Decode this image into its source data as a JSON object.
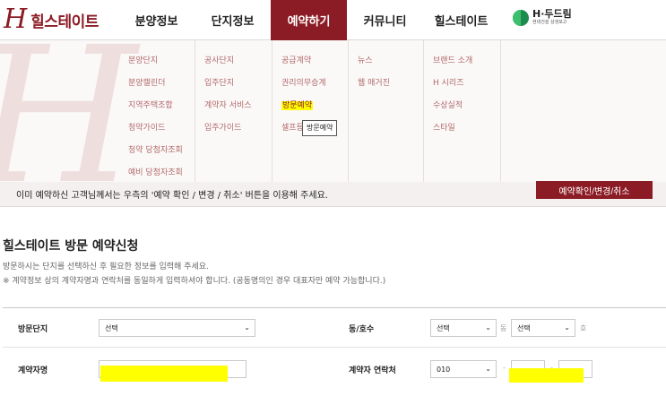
{
  "header": {
    "logo_mark": "H",
    "logo_text": "힐스테이트",
    "nav": [
      "분양정보",
      "단지정보",
      "예약하기",
      "커뮤니티",
      "힐스테이트"
    ],
    "partner_title": "H·두드림",
    "partner_sub": "현대건설 상생포고"
  },
  "mega_menu": {
    "columns": [
      [
        "분양단지",
        "분양캘린더",
        "지역주택조합",
        "청약가이드",
        "청약 당첨자조회",
        "예비 당첨자조회"
      ],
      [
        "공사단지",
        "입주단지",
        "계약자 서비스",
        "입주가이드"
      ],
      [
        "공급계약",
        "권리의무승계",
        "방문예약",
        "셀프등"
      ],
      [
        "뉴스",
        "웹 매거진"
      ],
      [
        "브랜드 소개",
        "H 시리즈",
        "수상실적",
        "스타일"
      ]
    ],
    "tooltip": "방문예약"
  },
  "notice": {
    "text": "이미 예약하신 고객님께서는 우측의 '예약 확인 / 변경 / 취소' 버튼을 이용해 주세요.",
    "button": "예약확인/변경/취소"
  },
  "page": {
    "title": "힐스테이트 방문 예약신청",
    "desc1": "방문하시는 단지를 선택하신 후 필요한 정보를 입력해 주세요.",
    "desc2": "※ 계약정보 상의 계약자명과 연락처를 동일하게 입력하셔야 합니다. (공동명의인 경우 대표자만 예약 가능합니다.)"
  },
  "form": {
    "visit_complex_label": "방문단지",
    "visit_complex_value": "선택",
    "dong_label": "동/호수",
    "dong_value": "선택",
    "dong_unit": "동",
    "ho_value": "선택",
    "ho_unit": "호",
    "contractor_name_label": "계약자명",
    "contractor_phone_label": "계약자 연락처",
    "phone_prefix": "010",
    "phone_sep": "-"
  },
  "colors": {
    "brand": "#8b1b24",
    "highlight": "#ffff00"
  }
}
